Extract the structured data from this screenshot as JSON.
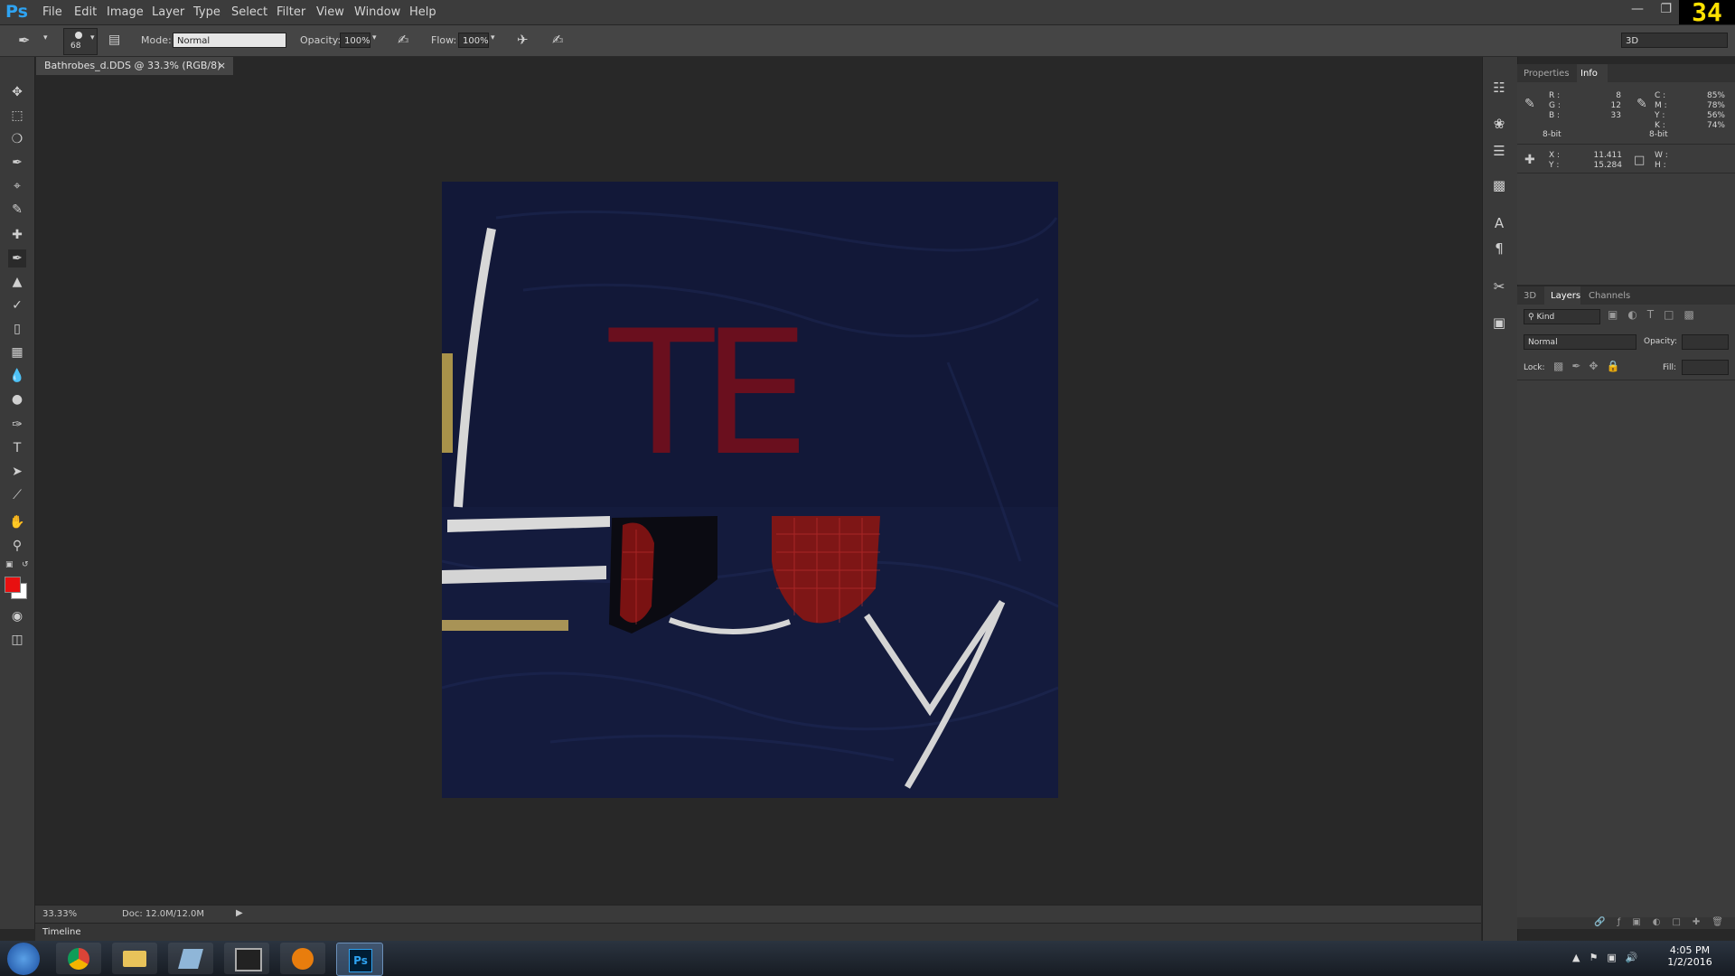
{
  "app": {
    "logo": "Ps",
    "counter": "34"
  },
  "menu": [
    "File",
    "Edit",
    "Image",
    "Layer",
    "Type",
    "Select",
    "Filter",
    "View",
    "Window",
    "Help"
  ],
  "options": {
    "brush_size": "68",
    "mode_label": "Mode:",
    "mode_value": "Normal",
    "opacity_label": "Opacity:",
    "opacity_value": "100%",
    "flow_label": "Flow:",
    "flow_value": "100%",
    "workspace": "3D"
  },
  "document": {
    "tab_title": "Bathrobes_d.DDS @ 33.3% (RGB/8)",
    "close": "×",
    "texture_letters": "TE"
  },
  "status": {
    "zoom": "33.33%",
    "doc": "Doc: 12.0M/12.0M",
    "timeline": "Timeline"
  },
  "info_panel": {
    "tabs": [
      "Properties",
      "Info"
    ],
    "rgb": {
      "r_label": "R :",
      "r": "8",
      "g_label": "G :",
      "g": "12",
      "b_label": "B :",
      "b": "33",
      "bit": "8-bit"
    },
    "cmyk": {
      "c_label": "C :",
      "c": "85%",
      "m_label": "M :",
      "m": "78%",
      "y_label": "Y :",
      "y": "56%",
      "k_label": "K :",
      "k": "74%",
      "bit": "8-bit"
    },
    "xy": {
      "x_label": "X :",
      "x": "11.411",
      "y_label": "Y :",
      "y": "15.284"
    },
    "wh": {
      "w_label": "W :",
      "h_label": "H :"
    }
  },
  "layers_panel": {
    "tabs": [
      "3D",
      "Layers",
      "Channels"
    ],
    "filter": "Kind",
    "blend": "Normal",
    "opacity_label": "Opacity:",
    "lock_label": "Lock:",
    "fill_label": "Fill:"
  },
  "taskbar": {
    "time": "4:05 PM",
    "date": "1/2/2016"
  },
  "colors": {
    "foreground": "#e81010",
    "background": "#ffffff",
    "accent": "#2ea3f2"
  }
}
